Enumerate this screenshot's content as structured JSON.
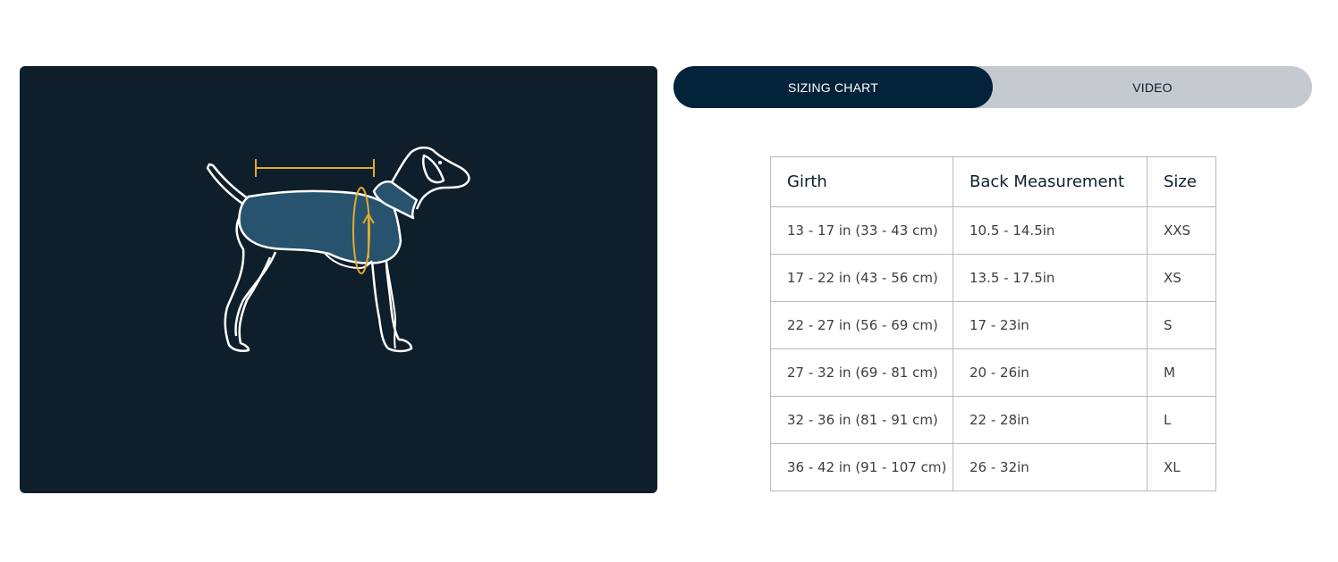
{
  "tabs": [
    {
      "label": "SIZING CHART",
      "active": true
    },
    {
      "label": "VIDEO",
      "active": false
    }
  ],
  "illustration": {
    "icon": "dog-measurement-icon",
    "colors": {
      "panel_bg": "#0e1f2b",
      "coat_fill": "#27536e",
      "outline": "#ffffff",
      "measure_line": "#e3a92b"
    }
  },
  "table": {
    "headers": [
      "Girth",
      "Back Measurement",
      "Size"
    ],
    "rows": [
      [
        "13 - 17 in (33 - 43 cm)",
        "10.5 - 14.5in",
        "XXS"
      ],
      [
        "17 - 22 in (43 - 56 cm)",
        "13.5 - 17.5in",
        "XS"
      ],
      [
        "22 - 27 in (56 - 69 cm)",
        "17 - 23in",
        "S"
      ],
      [
        "27 - 32 in (69 - 81 cm)",
        "20 - 26in",
        "M"
      ],
      [
        "32 - 36 in (81 - 91 cm)",
        "22 - 28in",
        "L"
      ],
      [
        "36 - 42 in (91 - 107 cm)",
        "26 - 32in",
        "XL"
      ]
    ]
  },
  "colors": {
    "tab_active_bg": "#03233a",
    "tab_inactive_bg": "#c5cad1",
    "table_border": "#b9b9b9"
  }
}
